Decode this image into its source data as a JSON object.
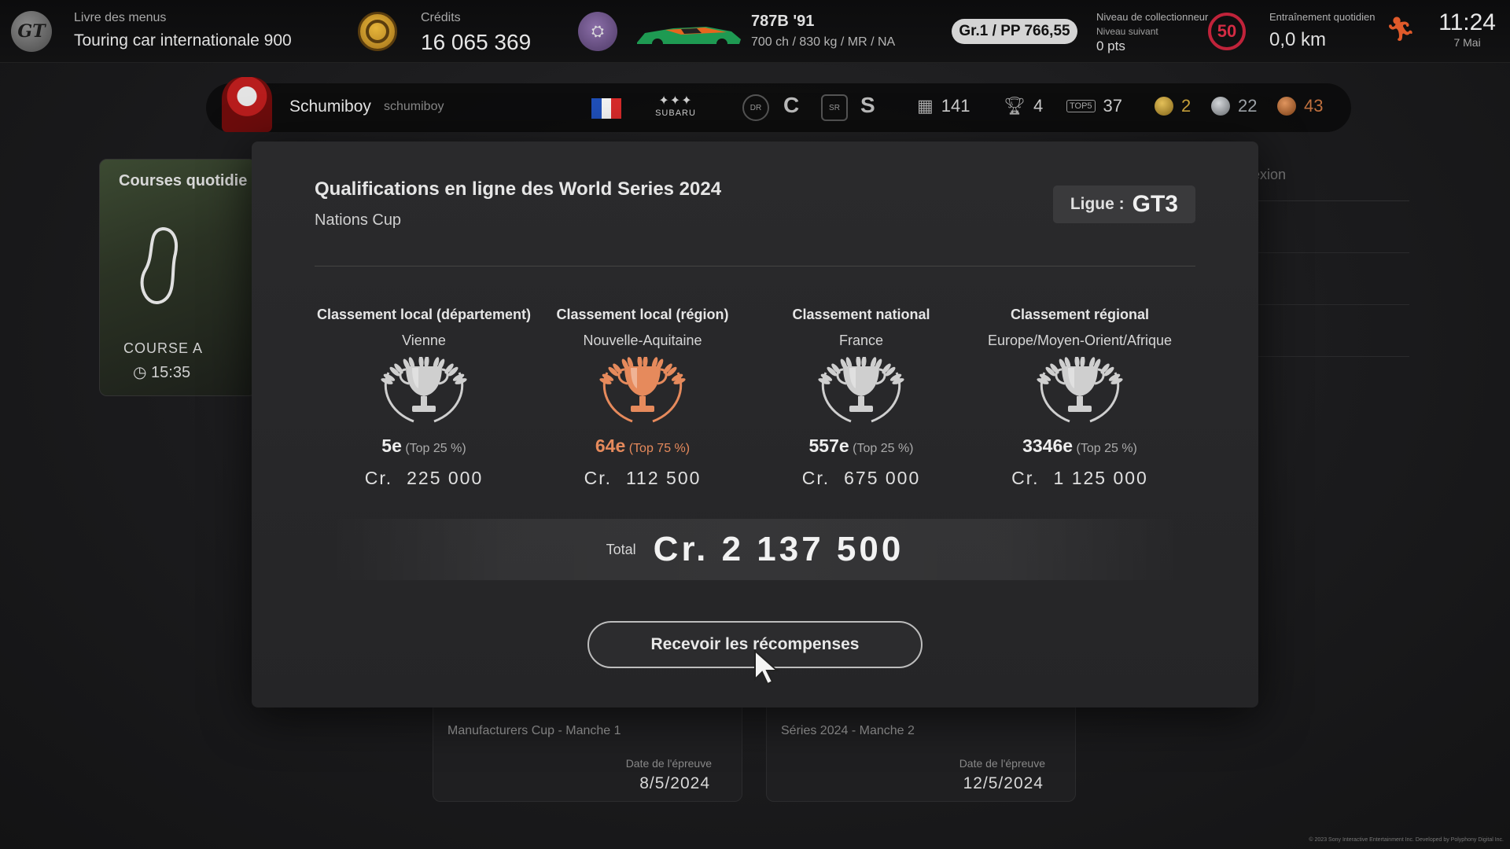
{
  "topbar": {
    "menu_book_label": "Livre des menus",
    "menu_book_value": "Touring car internationale 900",
    "credits_label": "Crédits",
    "credits_value": "16 065 369",
    "car_name": "787B '91",
    "car_specs": "700 ch / 830 kg / MR / NA",
    "car_class": "Gr.1 / PP 766,55",
    "collector_label": "Niveau de collectionneur",
    "collector_next_label": "Niveau suivant",
    "collector_next_value": "0 pts",
    "collector_level": "50",
    "training_label": "Entraînement quotidien",
    "training_value": "0,0 km",
    "time": "11:24",
    "date": "7 Mai"
  },
  "profile": {
    "name": "Schumiboy",
    "id": "schumiboy",
    "manufacturer": "SUBARU",
    "driver_rank": "C",
    "safety_rank": "S",
    "races": "141",
    "wins": "4",
    "top5": "37",
    "gold": "2",
    "silver": "22",
    "bronze": "43",
    "colors": {
      "gold": "#c9a23a",
      "silver": "#9ea3a8",
      "bronze": "#c0703e"
    }
  },
  "background": {
    "daily_title": "Courses quotidie",
    "daily_course": "COURSE A",
    "daily_time": "15:35",
    "right_header": "exion",
    "card1_name": "Manufacturers Cup - Manche 1",
    "card1_date_label": "Date de l'épreuve",
    "card1_date": "8/5/2024",
    "card2_name": "Séries 2024 - Manche 2",
    "card2_date_label": "Date de l'épreuve",
    "card2_date": "12/5/2024"
  },
  "modal": {
    "title": "Qualifications en ligne des World Series 2024",
    "subtitle": "Nations Cup",
    "league_label": "Ligue :",
    "league_value": "GT3",
    "rankings": [
      {
        "header": "Classement local (département)",
        "area": "Vienne",
        "position": "5e",
        "percentile": "(Top 25 %)",
        "currency": "Cr.",
        "reward": "225 000",
        "trophy": "silver"
      },
      {
        "header": "Classement local (région)",
        "area": "Nouvelle-Aquitaine",
        "position": "64e",
        "percentile": "(Top 75 %)",
        "currency": "Cr.",
        "reward": "112 500",
        "trophy": "bronze"
      },
      {
        "header": "Classement national",
        "area": "France",
        "position": "557e",
        "percentile": "(Top 25 %)",
        "currency": "Cr.",
        "reward": "675 000",
        "trophy": "silver"
      },
      {
        "header": "Classement régional",
        "area": "Europe/Moyen-Orient/Afrique",
        "position": "3346e",
        "percentile": "(Top 25 %)",
        "currency": "Cr.",
        "reward": "1 125 000",
        "trophy": "silver"
      }
    ],
    "total_label": "Total",
    "total_value": "Cr.  2 137 500",
    "claim_button": "Recevoir les récompenses",
    "colors": {
      "silver": "#cfcfcf",
      "bronze": "#e68a5c"
    }
  },
  "footer": {
    "copyright": "© 2023 Sony Interactive Entertainment Inc. Developed by Polyphony Digital Inc."
  }
}
